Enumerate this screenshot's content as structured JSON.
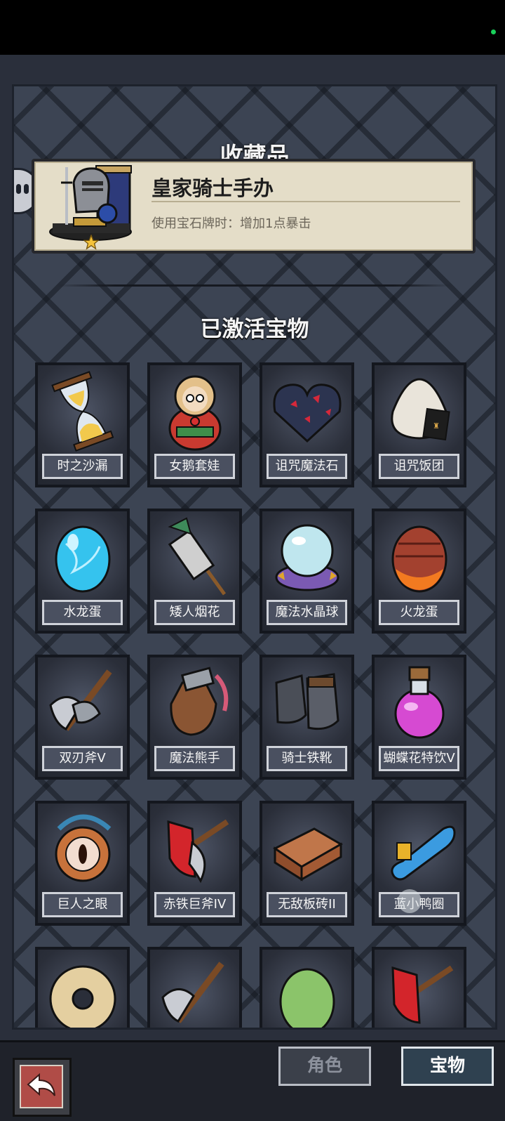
{
  "title": "收藏品",
  "featured": {
    "name": "皇家骑士手办",
    "description": "使用宝石牌时：增加1点暴击",
    "icon": "knight-figure-icon",
    "badge_icon": "star-icon"
  },
  "section_title": "已激活宝物",
  "items": [
    {
      "label": "时之沙漏",
      "icon": "hourglass-icon"
    },
    {
      "label": "女鹅套娃",
      "icon": "matryoshka-doll-icon"
    },
    {
      "label": "诅咒魔法石",
      "icon": "cursed-stone-icon"
    },
    {
      "label": "诅咒饭团",
      "icon": "rice-ball-icon"
    },
    {
      "label": "水龙蛋",
      "icon": "water-dragon-egg-icon"
    },
    {
      "label": "矮人烟花",
      "icon": "firework-icon"
    },
    {
      "label": "魔法水晶球",
      "icon": "crystal-ball-icon"
    },
    {
      "label": "火龙蛋",
      "icon": "fire-dragon-egg-icon"
    },
    {
      "label": "双刃斧V",
      "icon": "double-axe-icon"
    },
    {
      "label": "魔法熊手",
      "icon": "bear-paw-icon"
    },
    {
      "label": "骑士铁靴",
      "icon": "iron-boots-icon"
    },
    {
      "label": "蝴蝶花特饮V",
      "icon": "potion-icon"
    },
    {
      "label": "巨人之眼",
      "icon": "giant-eye-icon"
    },
    {
      "label": "赤铁巨斧IV",
      "icon": "red-axe-icon"
    },
    {
      "label": "无敌板砖II",
      "icon": "brick-icon"
    },
    {
      "label": "蓝小鸭圈",
      "icon": "duck-float-icon"
    },
    {
      "label": "",
      "icon": "donut-icon"
    },
    {
      "label": "",
      "icon": "double-axe-icon"
    },
    {
      "label": "",
      "icon": "green-egg-icon"
    },
    {
      "label": "",
      "icon": "red-axe-icon"
    }
  ],
  "bottom": {
    "back_icon": "back-arrow-icon",
    "tab_role": "角色",
    "tab_treasure": "宝物"
  },
  "colors": {
    "panel": "#3c4453",
    "card_label_border": "#cfd2d9",
    "featured_bg": "#e4ddc8",
    "back_button": "#b04c47"
  }
}
